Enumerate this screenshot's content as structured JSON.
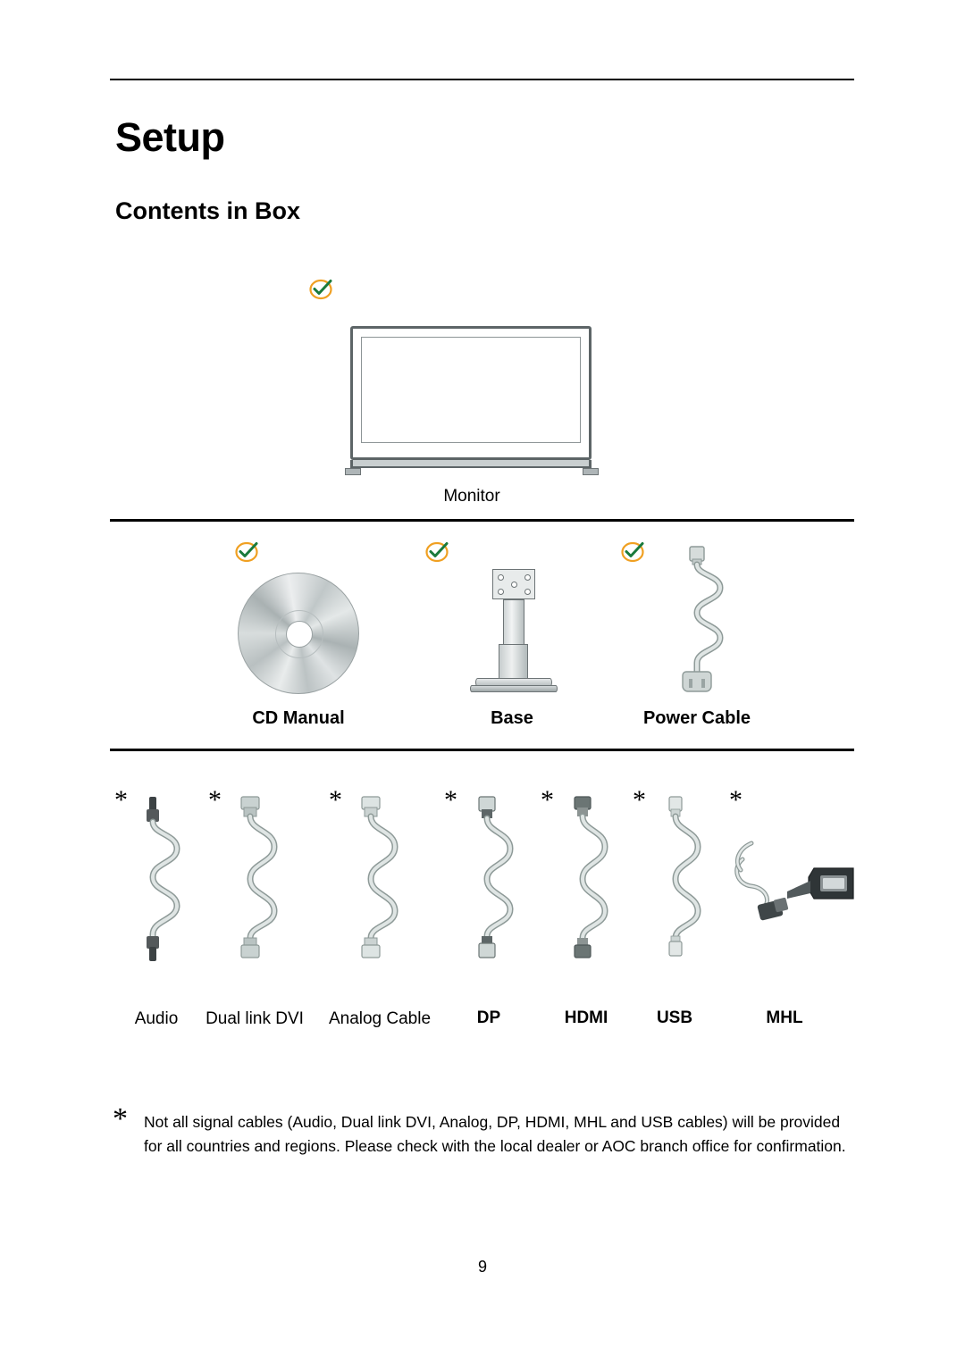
{
  "page": {
    "title": "Setup",
    "subtitle": "Contents in Box",
    "page_number": "9"
  },
  "sections": {
    "monitor": {
      "label": "Monitor",
      "badge": "check-badge"
    },
    "accessories": [
      {
        "label": "CD Manual",
        "badge": "check-badge"
      },
      {
        "label": "Base",
        "badge": "check-badge"
      },
      {
        "label": "Power Cable",
        "badge": "check-badge"
      }
    ],
    "cables": [
      {
        "label": "Audio",
        "mark": "*"
      },
      {
        "label": "Dual link DVI",
        "mark": "*"
      },
      {
        "label": "Analog Cable",
        "mark": "*"
      },
      {
        "label": "DP",
        "mark": "*"
      },
      {
        "label": "HDMI",
        "mark": "*"
      },
      {
        "label": "USB",
        "mark": "*"
      },
      {
        "label": "MHL",
        "mark": "*"
      }
    ]
  },
  "footnote": {
    "mark": "*",
    "text": "Not all signal cables (Audio, Dual link DVI, Analog, DP, HDMI, MHL and USB cables) will be provided for all countries and regions. Please check with the local dealer or AOC branch office for confirmation."
  },
  "colors": {
    "badge_ring": "#f0a022",
    "badge_check": "#1a7a3c",
    "cable_body": "#cfd8d6",
    "cable_outline": "#8e9a98",
    "rule": "#000000"
  }
}
